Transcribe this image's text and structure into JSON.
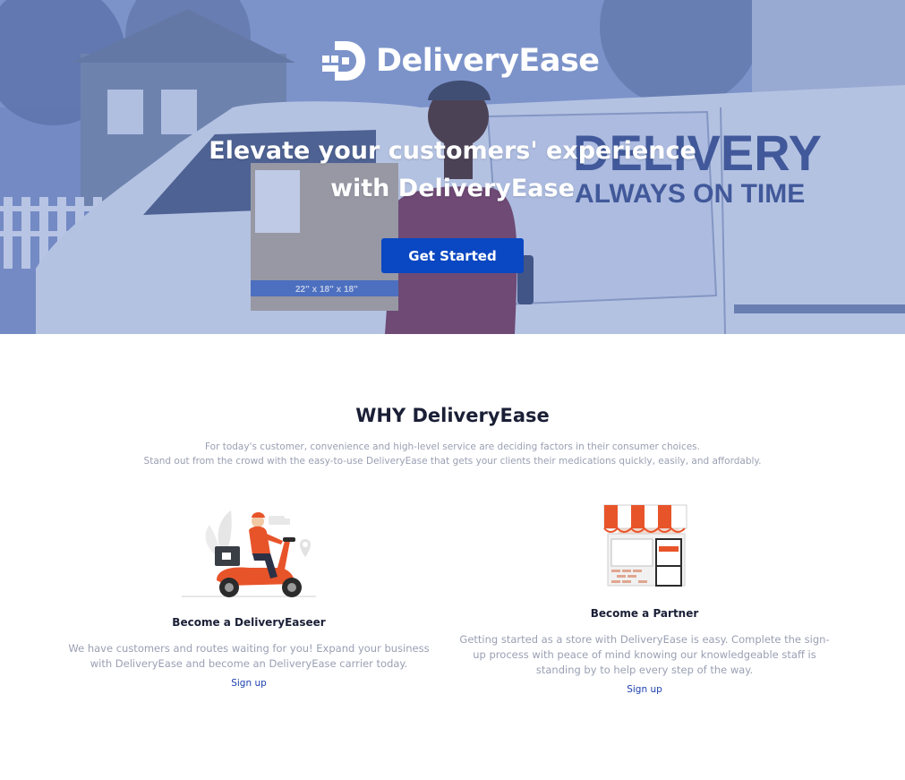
{
  "hero": {
    "brand": "DeliveryEase",
    "title_line1": "Elevate your customers' experience",
    "title_line2": "with DeliveryEase",
    "cta_label": "Get Started",
    "van_text_line1": "DELIVERY",
    "van_text_line2": "ALWAYS ON TIME",
    "box_label": "22\" x 18\" x 18\""
  },
  "why": {
    "title": "WHY DeliveryEase",
    "subtitle_line1": "For today's customer, convenience and high-level service are deciding factors in their consumer choices.",
    "subtitle_line2": "Stand out from the crowd with the easy-to-use DeliveryEase that gets your clients their medications quickly, easily, and affordably."
  },
  "features": [
    {
      "title": "Become a DeliveryEaseer",
      "text": "We have customers and routes waiting for you! Expand your business with DeliveryEase and become an DeliveryEase carrier today.",
      "link": "Sign up",
      "icon": "scooter-courier-illustration"
    },
    {
      "title": "Become a Partner",
      "text": "Getting started as a store with DeliveryEase is easy. Complete the sign-up process with peace of mind knowing our knowledgeable staff is standing by to help every step of the way.",
      "link": "Sign up",
      "icon": "storefront-illustration"
    }
  ],
  "colors": {
    "primary": "#0a47c2",
    "accent": "#f0572a",
    "text_dark": "#1a1f36",
    "text_muted": "#9aa0b3"
  }
}
